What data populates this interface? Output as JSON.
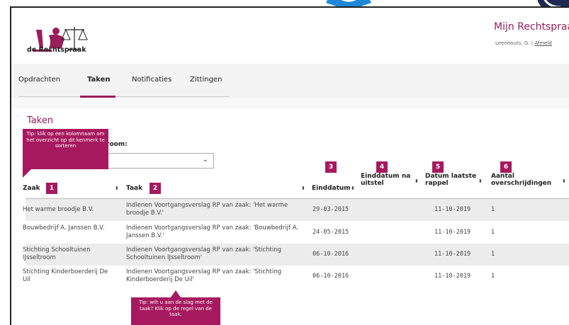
{
  "header": {
    "logo_text": "de Rechtspraak",
    "site_title": "Mijn Rechtspraa",
    "user_name": "Leenhouts, G.",
    "separator": "|",
    "logout_label": "Afmeld"
  },
  "nav": {
    "tabs": [
      {
        "label": "Opdrachten",
        "active": false
      },
      {
        "label": "Taken",
        "active": true
      },
      {
        "label": "Notificaties",
        "active": false
      },
      {
        "label": "Zittingen",
        "active": false
      }
    ]
  },
  "page": {
    "title": "Taken",
    "filter_label_visible": "room:",
    "filter_value": ""
  },
  "tips": {
    "sort_tip": "Tip: klik op een kolomnaam om het overzicht op dit kenmerk te sorteren",
    "row_tip": "Tip: wilt u aan de slag met de taak? Klik op de regel van de taak."
  },
  "table": {
    "columns": [
      {
        "label": "Zaak",
        "badge": "1"
      },
      {
        "label": "Taak",
        "badge": "2"
      },
      {
        "label": "Einddatum",
        "badge": "3"
      },
      {
        "label": "Einddatum na uitstel",
        "badge": "4"
      },
      {
        "label": "Datum laatste rappel",
        "badge": "5"
      },
      {
        "label": "Aantal overschrijdingen",
        "badge": "6"
      }
    ],
    "sort_icon": "⬍",
    "rows": [
      {
        "zaak": "Het warme broodje B.V.",
        "taak": "Indienen Voortgangsverslag RP van zaak: 'Het warme broodje B.V.'",
        "einddatum": "29-03-2015",
        "uitstel": "",
        "rappel": "11-10-2019",
        "overschrijdingen": "1"
      },
      {
        "zaak": "Bouwbedrijf A. Janssen B.V.",
        "taak": "Indienen Voortgangsverslag RP van zaak: 'Bouwbedrijf A. Janssen B.V.'",
        "einddatum": "24-05-2015",
        "uitstel": "",
        "rappel": "11-10-2019",
        "overschrijdingen": "1"
      },
      {
        "zaak": "Stichting Schooltuinen IJsseltroom",
        "taak": "Indienen Voortgangsverslag RP van zaak: 'Stichting Schooltuinen IJsseltroom'",
        "einddatum": "06-10-2016",
        "uitstel": "",
        "rappel": "11-10-2019",
        "overschrijdingen": "1"
      },
      {
        "zaak": "Stichting Kinderboerderij De Uil",
        "taak": "Indienen Voortgangsverslag RP van zaak: 'Stichting Kinderboerderij De Uil'",
        "einddatum": "06-10-2016",
        "uitstel": "",
        "rappel": "11-10-2019",
        "overschrijdingen": "1"
      }
    ]
  },
  "colors": {
    "brand": "#9b1d5a",
    "tip_bg": "#a6195f",
    "row_stripe": "#ececec"
  }
}
